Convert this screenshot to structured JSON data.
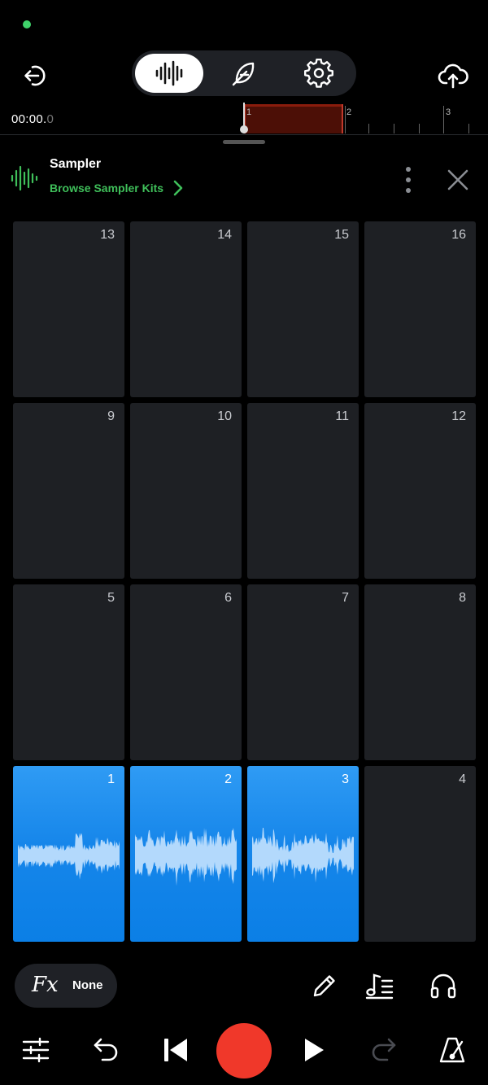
{
  "timeline": {
    "time_main": "00:00.",
    "time_fraction": "0",
    "bars": [
      "1",
      "2",
      "3"
    ]
  },
  "instrument": {
    "title": "Sampler",
    "browse_label": "Browse Sampler Kits"
  },
  "pads": [
    {
      "number": "13",
      "loaded": false
    },
    {
      "number": "14",
      "loaded": false
    },
    {
      "number": "15",
      "loaded": false
    },
    {
      "number": "16",
      "loaded": false
    },
    {
      "number": "9",
      "loaded": false
    },
    {
      "number": "10",
      "loaded": false
    },
    {
      "number": "11",
      "loaded": false
    },
    {
      "number": "12",
      "loaded": false
    },
    {
      "number": "5",
      "loaded": false
    },
    {
      "number": "6",
      "loaded": false
    },
    {
      "number": "7",
      "loaded": false
    },
    {
      "number": "8",
      "loaded": false
    },
    {
      "number": "1",
      "loaded": true
    },
    {
      "number": "2",
      "loaded": true
    },
    {
      "number": "3",
      "loaded": true
    },
    {
      "number": "4",
      "loaded": false
    }
  ],
  "fx": {
    "label": "Fx",
    "value": "None"
  },
  "colors": {
    "accent_green": "#3fbf5a",
    "pad_active": "#1686ea",
    "record": "#f0382a",
    "loop_region": "#4c0f06"
  },
  "icons": {
    "exit": "exit-icon",
    "waveform": "waveform-icon",
    "feather": "feather-icon",
    "gear": "gear-icon",
    "upload": "cloud-upload-icon",
    "more": "more-vertical-icon",
    "close": "close-icon",
    "edit": "pencil-icon",
    "notes": "note-list-icon",
    "headphones": "headphones-icon",
    "mixer": "sliders-icon",
    "undo": "undo-icon",
    "rewind": "skip-back-icon",
    "play": "play-icon",
    "redo": "redo-icon",
    "metronome": "metronome-icon"
  }
}
